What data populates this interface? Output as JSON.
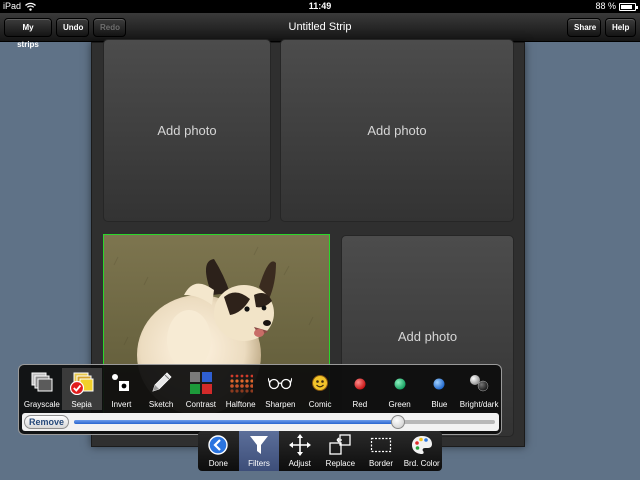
{
  "status_bar": {
    "carrier": "iPad",
    "time": "11:49",
    "battery": "88 %",
    "battery_level": 0.88
  },
  "nav_bar": {
    "title": "Untitled Strip",
    "my_strips": "My strips",
    "undo": "Undo",
    "redo": "Redo",
    "share": "Share",
    "help": "Help"
  },
  "panels": {
    "top_left": "Add photo",
    "top_right": "Add photo",
    "bottom_right": "Add photo"
  },
  "filters": {
    "items": [
      {
        "label": "Grayscale",
        "icon": "grayscale-icon"
      },
      {
        "label": "Sepia",
        "icon": "sepia-icon"
      },
      {
        "label": "Invert",
        "icon": "invert-icon"
      },
      {
        "label": "Sketch",
        "icon": "pencil-icon"
      },
      {
        "label": "Contrast",
        "icon": "contrast-icon"
      },
      {
        "label": "Halftone",
        "icon": "halftone-icon"
      },
      {
        "label": "Sharpen",
        "icon": "glasses-icon"
      },
      {
        "label": "Comic",
        "icon": "comic-face-icon"
      },
      {
        "label": "Red",
        "icon": "red-dot-icon"
      },
      {
        "label": "Green",
        "icon": "green-dot-icon"
      },
      {
        "label": "Blue",
        "icon": "blue-dot-icon"
      },
      {
        "label": "Bright/dark",
        "icon": "bright-dark-icon"
      }
    ],
    "selected": "Sepia",
    "remove_label": "Remove",
    "slider_level": 0.77
  },
  "tabs": {
    "items": [
      {
        "label": "Done",
        "icon": "back-arrow-icon"
      },
      {
        "label": "Filters",
        "icon": "funnel-icon"
      },
      {
        "label": "Adjust",
        "icon": "move-arrows-icon"
      },
      {
        "label": "Replace",
        "icon": "replace-icon"
      },
      {
        "label": "Border",
        "icon": "dashed-border-icon"
      },
      {
        "label": "Brd. Color",
        "icon": "palette-icon"
      }
    ],
    "selected": "Filters"
  },
  "colors": {
    "background": "#5f7287",
    "selection_border": "#2bd62b",
    "slider_fill": "#2a66cf",
    "tab_selected": "#4a5c88"
  }
}
